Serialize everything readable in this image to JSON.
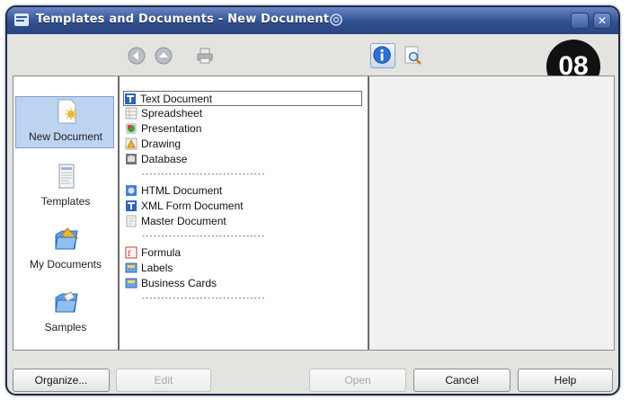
{
  "window": {
    "title": "Templates and Documents - New Document"
  },
  "badge": "08",
  "toolbar": {
    "back_icon": "back-arrow-icon",
    "up_icon": "up-arrow-icon",
    "print_icon": "print-icon",
    "info_icon": "info-icon",
    "preview_icon": "preview-magnifier-icon"
  },
  "categories": [
    {
      "label": "New Document",
      "selected": true
    },
    {
      "label": "Templates"
    },
    {
      "label": "My Documents"
    },
    {
      "label": "Samples"
    }
  ],
  "items": [
    {
      "label": "Text Document",
      "icon": "text-doc-icon",
      "selected": true
    },
    {
      "label": "Spreadsheet",
      "icon": "spreadsheet-icon"
    },
    {
      "label": "Presentation",
      "icon": "presentation-icon"
    },
    {
      "label": "Drawing",
      "icon": "drawing-icon"
    },
    {
      "label": "Database",
      "icon": "database-icon"
    },
    {
      "label": "HTML Document",
      "icon": "html-doc-icon"
    },
    {
      "label": "XML Form Document",
      "icon": "xml-form-icon"
    },
    {
      "label": "Master Document",
      "icon": "master-doc-icon"
    },
    {
      "label": "Formula",
      "icon": "formula-icon"
    },
    {
      "label": "Labels",
      "icon": "labels-icon"
    },
    {
      "label": "Business Cards",
      "icon": "business-cards-icon"
    }
  ],
  "separator": "------------------------------------------------",
  "buttons": {
    "organize": "Organize...",
    "edit": "Edit",
    "open": "Open",
    "cancel": "Cancel",
    "help": "Help"
  },
  "colors": {
    "titlebar": "#2f4f8f",
    "selection": "#bcd3f2"
  }
}
